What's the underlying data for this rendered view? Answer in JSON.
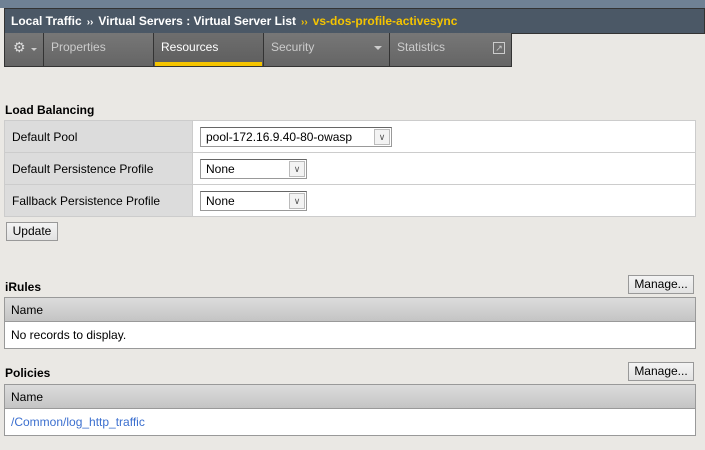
{
  "breadcrumb": {
    "items": [
      "Local Traffic",
      "Virtual Servers : Virtual Server List"
    ],
    "current": "vs-dos-profile-activesync",
    "separator": "››"
  },
  "tabs": [
    {
      "label": "Properties"
    },
    {
      "label": "Resources",
      "active": true
    },
    {
      "label": "Security"
    },
    {
      "label": "Statistics"
    }
  ],
  "load_balancing": {
    "title": "Load Balancing",
    "rows": [
      {
        "label": "Default Pool",
        "value": "pool-172.16.9.40-80-owasp"
      },
      {
        "label": "Default Persistence Profile",
        "value": "None"
      },
      {
        "label": "Fallback Persistence Profile",
        "value": "None"
      }
    ],
    "update_label": "Update"
  },
  "irules": {
    "title": "iRules",
    "manage_label": "Manage...",
    "column": "Name",
    "empty": "No records to display."
  },
  "policies": {
    "title": "Policies",
    "manage_label": "Manage...",
    "column": "Name",
    "rows": [
      "/Common/log_http_traffic"
    ]
  },
  "colors": {
    "accent": "#f5c400",
    "link": "#3b6fcf",
    "header": "#4b5866"
  }
}
